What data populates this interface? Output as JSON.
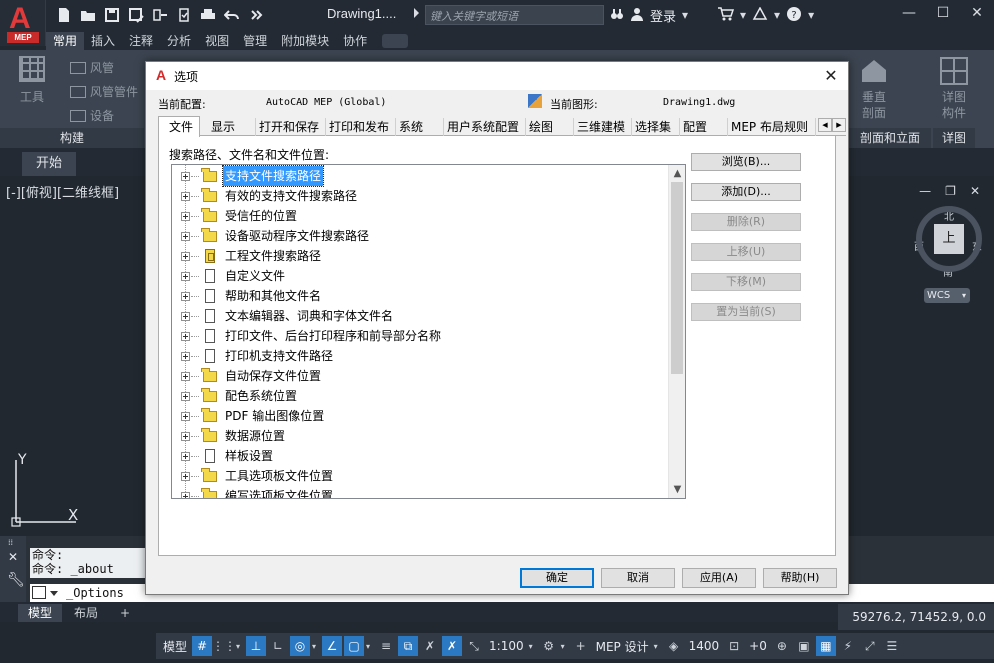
{
  "app": {
    "logo_text": "A",
    "logo_badge": "MEP",
    "document_title": "Drawing1....",
    "search_placeholder": "键入关键字或短语",
    "login_label": "登录"
  },
  "ribbon": {
    "tabs": [
      "常用",
      "插入",
      "注释",
      "分析",
      "视图",
      "管理",
      "附加模块",
      "协作"
    ],
    "active_tab": "常用",
    "panel_build": {
      "tool_label": "工具",
      "duct_label": "风管",
      "duct_fitting_label": "风管管件",
      "equipment_label": "设备",
      "footer": "构建"
    },
    "panel_section": {
      "vertical_section_label": "垂直剖面",
      "footer": "剖面和立面"
    },
    "panel_detail": {
      "detail_component_label": "详图构件",
      "footer": "详图"
    }
  },
  "file_tab": {
    "label": "开始"
  },
  "viewport": {
    "view_label": "[-][俯视][二维线框]",
    "viewcube_face": "上",
    "compass_n": "北",
    "compass_s": "南",
    "compass_e": "东",
    "compass_w": "西",
    "wcs_label": "WCS",
    "ucs_x": "X",
    "ucs_y": "Y"
  },
  "command_line": {
    "history": [
      "命令:",
      "命令: _about"
    ],
    "input": "_Options"
  },
  "layout_tabs": {
    "model": "模型",
    "layout": "布局",
    "add": "+"
  },
  "status_bar": {
    "coordinates": "59276.2, 71452.9, 0.0",
    "model_label": "模型",
    "scale": "1:100",
    "workspace": "MEP 设计",
    "elevation": "1400",
    "offset": "+0"
  },
  "dialog": {
    "title": "选项",
    "current_profile_label": "当前配置:",
    "current_profile_value": "AutoCAD MEP (Global)",
    "current_drawing_label": "当前图形:",
    "current_drawing_value": "Drawing1.dwg",
    "tabs": [
      "文件",
      "显示",
      "打开和保存",
      "打印和发布",
      "系统",
      "用户系统配置",
      "绘图",
      "三维建模",
      "选择集",
      "配置",
      "MEP 布局规则"
    ],
    "active_tab": "文件",
    "page_label": "搜索路径、文件名和文件位置:",
    "tree_items": [
      {
        "label": "支持文件搜索路径",
        "icon": "folder-icon",
        "selected": true
      },
      {
        "label": "有效的支持文件搜索路径",
        "icon": "folder-icon"
      },
      {
        "label": "受信任的位置",
        "icon": "folder-icon"
      },
      {
        "label": "设备驱动程序文件搜索路径",
        "icon": "folder-icon"
      },
      {
        "label": "工程文件搜索路径",
        "icon": "project-file-icon"
      },
      {
        "label": "自定义文件",
        "icon": "document-icon"
      },
      {
        "label": "帮助和其他文件名",
        "icon": "document-icon"
      },
      {
        "label": "文本编辑器、词典和字体文件名",
        "icon": "document-icon"
      },
      {
        "label": "打印文件、后台打印程序和前导部分名称",
        "icon": "document-icon"
      },
      {
        "label": "打印机支持文件路径",
        "icon": "document-icon"
      },
      {
        "label": "自动保存文件位置",
        "icon": "folder-icon"
      },
      {
        "label": "配色系统位置",
        "icon": "folder-icon"
      },
      {
        "label": "PDF 输出图像位置",
        "icon": "folder-icon"
      },
      {
        "label": "数据源位置",
        "icon": "folder-icon"
      },
      {
        "label": "样板设置",
        "icon": "document-icon"
      },
      {
        "label": "工具选项板文件位置",
        "icon": "folder-icon"
      },
      {
        "label": "编写选项板文件位置",
        "icon": "folder-icon"
      }
    ],
    "side_buttons": [
      {
        "label": "浏览(B)...",
        "enabled": true
      },
      {
        "label": "添加(D)...",
        "enabled": true
      },
      {
        "label": "删除(R)",
        "enabled": false
      },
      {
        "label": "上移(U)",
        "enabled": false
      },
      {
        "label": "下移(M)",
        "enabled": false
      },
      {
        "label": "置为当前(S)",
        "enabled": false
      }
    ],
    "buttons": {
      "ok": "确定",
      "cancel": "取消",
      "apply": "应用(A)",
      "help": "帮助(H)"
    }
  },
  "colors": {
    "accent": "#2b79c2",
    "selection": "#3399ff",
    "logo_red": "#e23a3a"
  }
}
